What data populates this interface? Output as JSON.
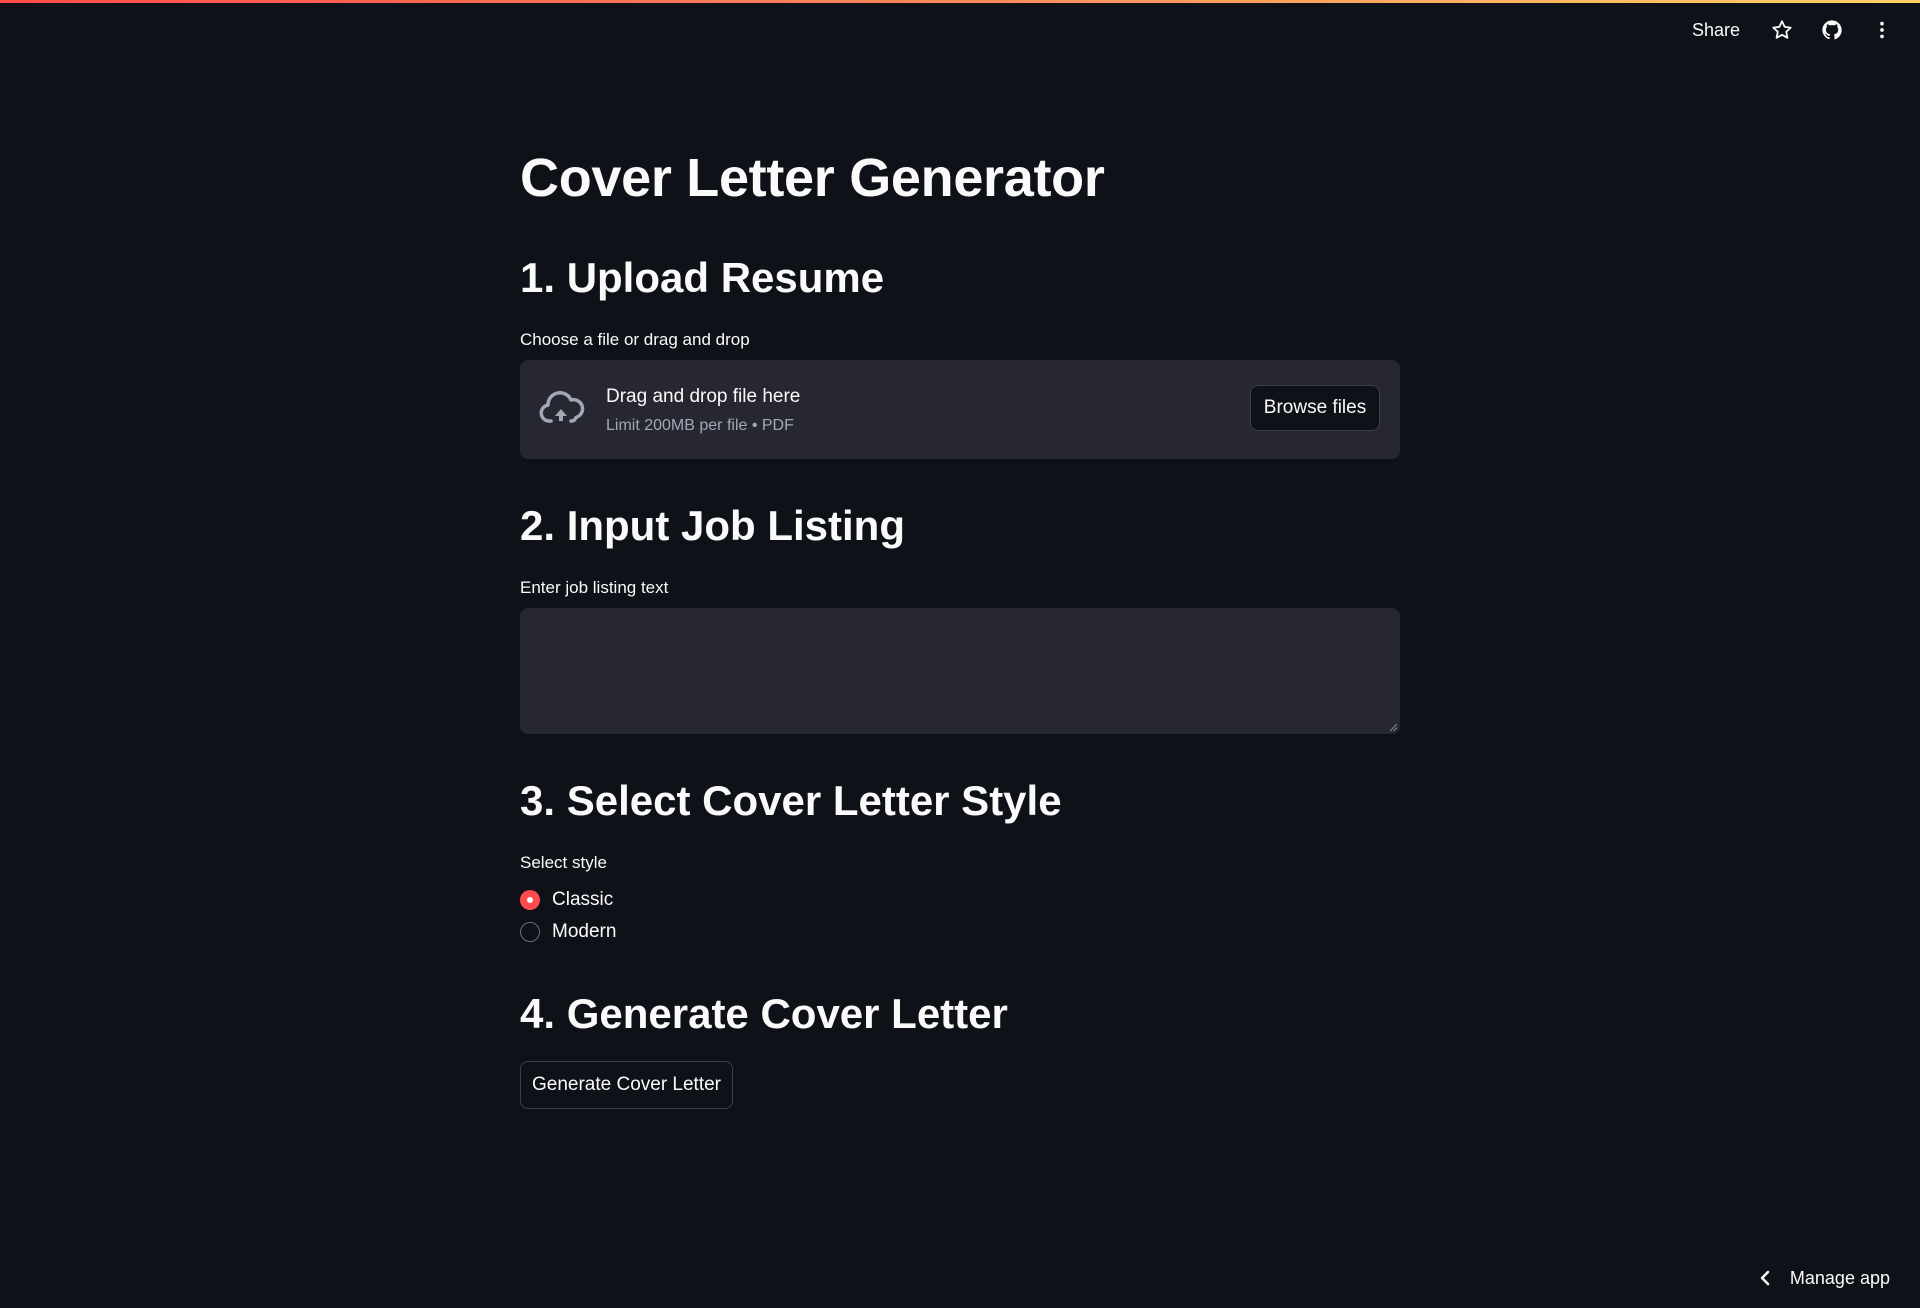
{
  "header": {
    "share_label": "Share",
    "icons": [
      "star-icon",
      "github-icon",
      "more-vertical-icon"
    ]
  },
  "page": {
    "title": "Cover Letter Generator"
  },
  "sections": {
    "upload": {
      "title": "1. Upload Resume",
      "label": "Choose a file or drag and drop",
      "dropzone_title": "Drag and drop file here",
      "dropzone_subtitle": "Limit 200MB per file • PDF",
      "browse_label": "Browse files"
    },
    "job": {
      "title": "2. Input Job Listing",
      "label": "Enter job listing text",
      "value": "",
      "placeholder": ""
    },
    "style": {
      "title": "3. Select Cover Letter Style",
      "label": "Select style",
      "options": [
        {
          "label": "Classic",
          "selected": true
        },
        {
          "label": "Modern",
          "selected": false
        }
      ]
    },
    "generate": {
      "title": "4. Generate Cover Letter",
      "button_label": "Generate Cover Letter"
    }
  },
  "footer": {
    "manage_app_label": "Manage app"
  },
  "colors": {
    "background": "#0e1117",
    "surface": "#262730",
    "accent": "#ff4b4b",
    "text": "#fafafa",
    "muted_text": "#a3a8b8"
  }
}
